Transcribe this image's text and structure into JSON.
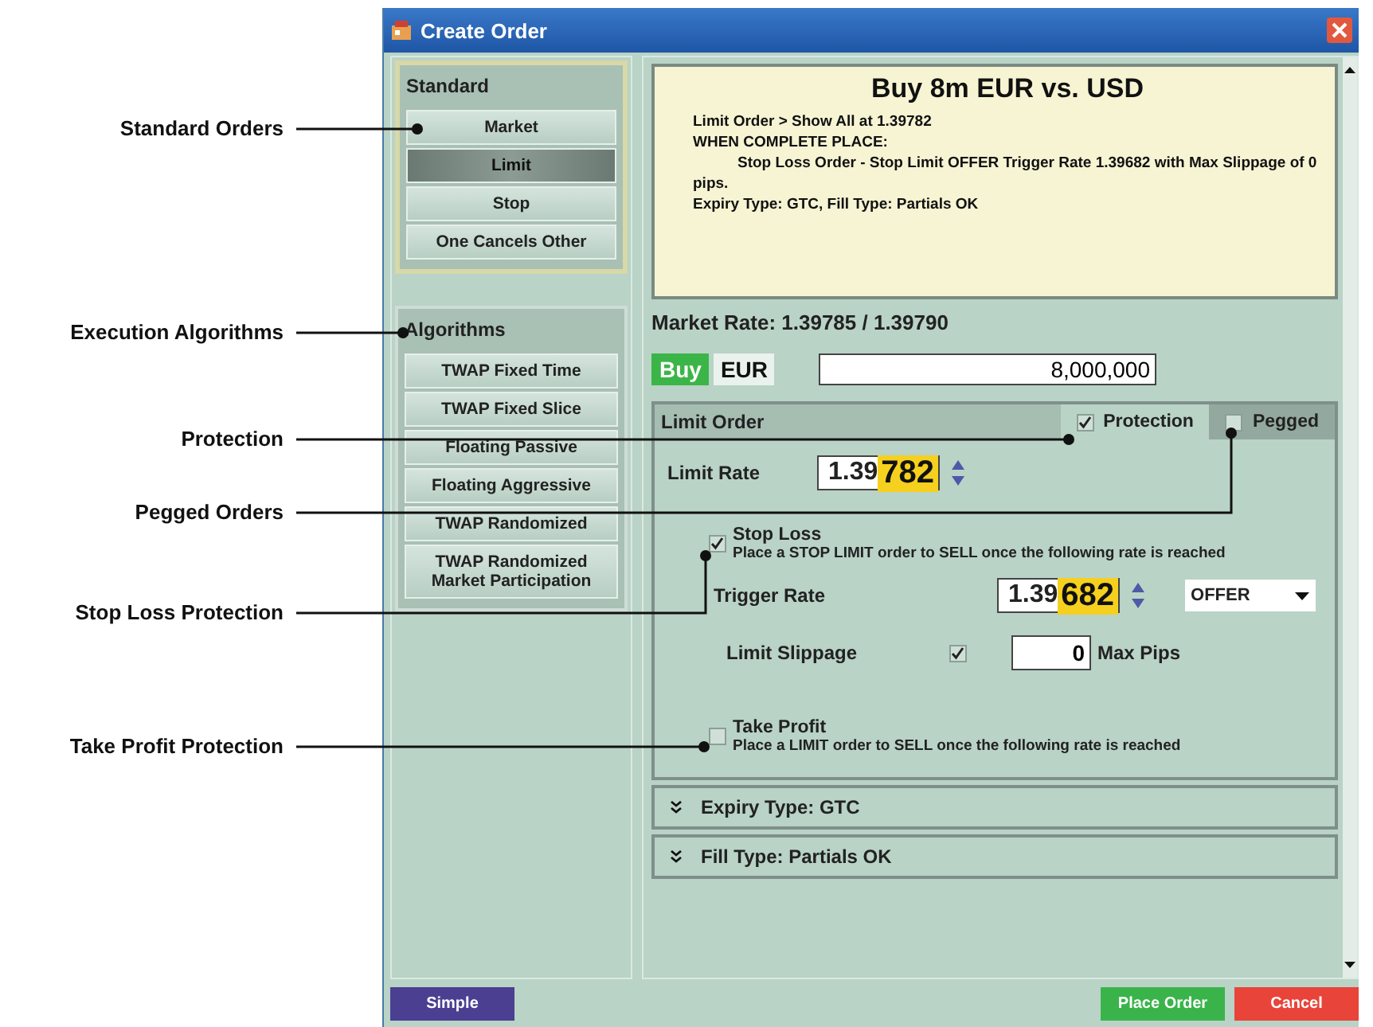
{
  "callouts": [
    {
      "label": "Standard Orders"
    },
    {
      "label": "Execution Algorithms"
    },
    {
      "label": "Protection"
    },
    {
      "label": "Pegged Orders"
    },
    {
      "label": "Stop Loss Protection"
    },
    {
      "label": "Take Profit Protection"
    }
  ],
  "window": {
    "title": "Create Order"
  },
  "standard": {
    "title": "Standard",
    "items": [
      {
        "label": "Market",
        "selected": false
      },
      {
        "label": "Limit",
        "selected": true
      },
      {
        "label": "Stop",
        "selected": false
      },
      {
        "label": "One Cancels Other",
        "selected": false
      }
    ]
  },
  "algorithms": {
    "title": "Algorithms",
    "items": [
      {
        "label": "TWAP Fixed Time",
        "selected": false
      },
      {
        "label": "TWAP Fixed Slice",
        "selected": false
      },
      {
        "label": "Floating Passive",
        "selected": false
      },
      {
        "label": "Floating Aggressive",
        "selected": false
      },
      {
        "label": "TWAP Randomized",
        "selected": false
      },
      {
        "label": "TWAP Randomized Market Participation",
        "selected": false
      }
    ]
  },
  "summary": {
    "title": "Buy 8m EUR vs. USD",
    "lines": [
      {
        "text": "Limit Order > Show All at 1.39782",
        "kind": "plain"
      },
      {
        "text": "WHEN COMPLETE PLACE:",
        "kind": "plain"
      },
      {
        "text": "Stop Loss Order  - Stop Limit OFFER Trigger Rate 1.39682 with Max Slippage of 0 pips.",
        "kind": "indented"
      },
      {
        "text": "Expiry Type: GTC, Fill Type: Partials OK",
        "kind": "plain"
      }
    ]
  },
  "market_rate": "Market Rate: 1.39785 / 1.39790",
  "side": "Buy",
  "currency": "EUR",
  "amount": "8,000,000",
  "limit_order": {
    "title": "Limit Order",
    "tabs": [
      {
        "label": "Protection",
        "checked": true,
        "selected": true
      },
      {
        "label": "Pegged",
        "checked": false,
        "selected": false
      }
    ],
    "limit_rate": {
      "label": "Limit Rate",
      "prefix": "1.39",
      "highlight": "782"
    },
    "stop_loss": {
      "checked": true,
      "title": "Stop Loss",
      "description": "Place a STOP LIMIT order to SELL once the following rate is reached",
      "trigger_label": "Trigger Rate",
      "trigger_prefix": "1.39",
      "trigger_highlight": "682",
      "trigger_side": "OFFER",
      "slippage_label": "Limit Slippage",
      "slippage_checked": true,
      "slippage_value": "0",
      "slippage_unit": "Max Pips"
    },
    "take_profit": {
      "checked": false,
      "title": "Take Profit",
      "description": "Place a LIMIT order to SELL once the following rate is reached"
    }
  },
  "sections": [
    {
      "label": "Expiry Type: GTC",
      "expanded": false
    },
    {
      "label": "Fill Type: Partials OK",
      "expanded": false
    }
  ],
  "buttons": [
    {
      "label": "Simple",
      "kind": "mode"
    },
    {
      "label": "Place Order",
      "kind": "confirm"
    },
    {
      "label": "Cancel",
      "kind": "cancel"
    }
  ]
}
